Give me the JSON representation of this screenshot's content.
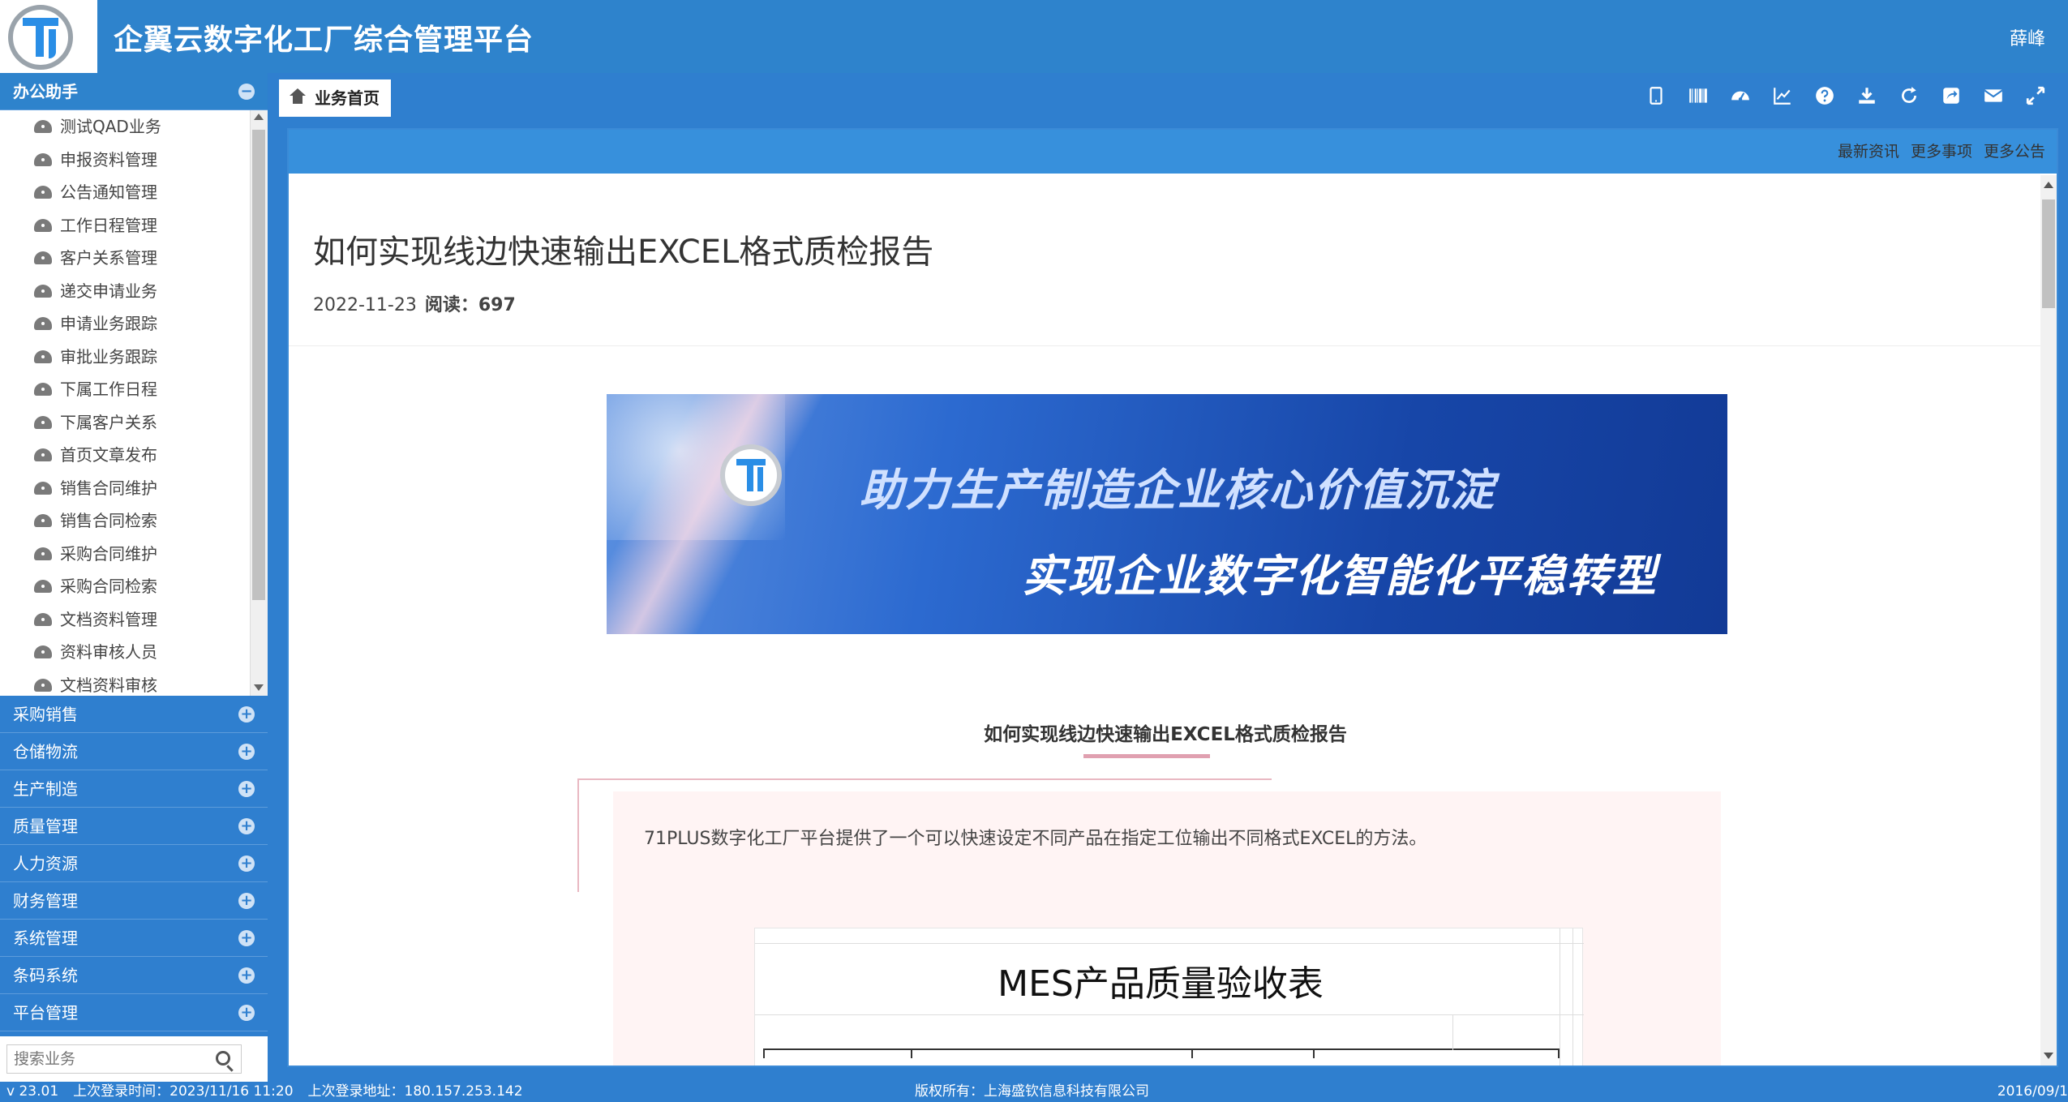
{
  "app": {
    "title": "企翼云数字化工厂综合管理平台",
    "user": "薛峰"
  },
  "sidebar": {
    "active_group": {
      "label": "办公助手",
      "toggle": "−"
    },
    "items": [
      {
        "label": "测试QAD业务"
      },
      {
        "label": "申报资料管理"
      },
      {
        "label": "公告通知管理"
      },
      {
        "label": "工作日程管理"
      },
      {
        "label": "客户关系管理"
      },
      {
        "label": "递交申请业务"
      },
      {
        "label": "申请业务跟踪"
      },
      {
        "label": "审批业务跟踪"
      },
      {
        "label": "下属工作日程"
      },
      {
        "label": "下属客户关系"
      },
      {
        "label": "首页文章发布"
      },
      {
        "label": "销售合同维护"
      },
      {
        "label": "销售合同检索"
      },
      {
        "label": "采购合同维护"
      },
      {
        "label": "采购合同检索"
      },
      {
        "label": "文档资料管理"
      },
      {
        "label": "资料审核人员"
      },
      {
        "label": "文档资料审核"
      }
    ],
    "groups": [
      {
        "label": "采购销售",
        "toggle": "+"
      },
      {
        "label": "仓储物流",
        "toggle": "+"
      },
      {
        "label": "生产制造",
        "toggle": "+"
      },
      {
        "label": "质量管理",
        "toggle": "+"
      },
      {
        "label": "人力资源",
        "toggle": "+"
      },
      {
        "label": "财务管理",
        "toggle": "+"
      },
      {
        "label": "系统管理",
        "toggle": "+"
      },
      {
        "label": "条码系统",
        "toggle": "+"
      },
      {
        "label": "平台管理",
        "toggle": "+"
      }
    ],
    "search": {
      "placeholder": "搜索业务",
      "value": ""
    }
  },
  "tabs": [
    {
      "label": "业务首页",
      "icon": "home-icon"
    }
  ],
  "toolbar_icons": [
    "tablet-icon",
    "barcode-icon",
    "dashboard-icon",
    "line-chart-icon",
    "help-icon",
    "download-icon",
    "refresh-icon",
    "share-icon",
    "mail-icon",
    "fullscreen-icon"
  ],
  "frame": {
    "links": {
      "news": "最新资讯",
      "tasks": "更多事项",
      "notices": "更多公告"
    }
  },
  "article": {
    "title": "如何实现线边快速输出EXCEL格式质检报告",
    "date": "2022-11-23",
    "reads_label": "阅读：697",
    "banner_line1": "助力生产制造企业核心价值沉淀",
    "banner_line2": "实现企业数字化智能化平稳转型",
    "subtitle": "如何实现线边快速输出EXCEL格式质检报告",
    "intro": "71PLUS数字化工厂平台提供了一个可以快速设定不同产品在指定工位输出不同格式EXCEL的方法。",
    "sheet_title": "MES产品质量验收表"
  },
  "status": {
    "version": "v 23.01",
    "last_login_time": "上次登录时间：2023/11/16 11:20",
    "last_login_addr": "上次登录地址：180.157.253.142",
    "copyright": "版权所有：上海盛钦信息科技有限公司",
    "right_date": "2016/09/1"
  },
  "colors": {
    "header": "#2e83cc",
    "sidebar": "#2f7fcf",
    "frame_bar": "#3790dc"
  }
}
